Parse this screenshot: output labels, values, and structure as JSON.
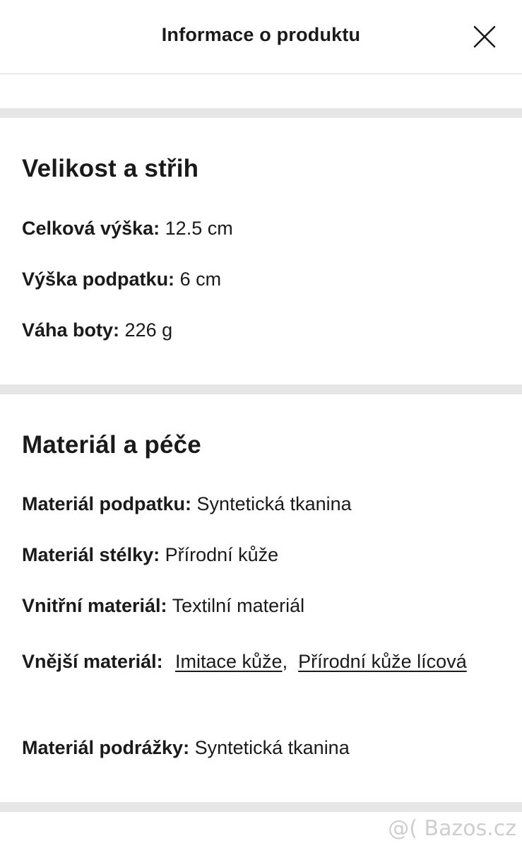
{
  "header": {
    "title": "Informace o produktu",
    "close_icon": "close-icon"
  },
  "size_section": {
    "title": "Velikost a střih",
    "rows": [
      {
        "label": "Celková výška:",
        "value": "12.5 cm"
      },
      {
        "label": "Výška podpatku:",
        "value": "6 cm"
      },
      {
        "label": "Váha boty:",
        "value": "226 g"
      }
    ]
  },
  "material_section": {
    "title": "Materiál a péče",
    "rows": [
      {
        "label": "Materiál podpatku:",
        "value": "Syntetická tkanina"
      },
      {
        "label": "Materiál stélky:",
        "value": "Přírodní kůže"
      },
      {
        "label": "Vnitřní materiál:",
        "value": "Textilní materiál"
      }
    ],
    "outer": {
      "label": "Vnější materiál:",
      "links": [
        "Imitace kůže",
        "Přírodní kůže lícová"
      ],
      "separator": ","
    },
    "last_row": {
      "label": "Materiál podrážky:",
      "value": "Syntetická tkanina"
    }
  },
  "watermark": "@( Bazos.cz",
  "colors": {
    "text": "#1a1a1a",
    "divider": "#e6e6e6",
    "background": "#ffffff"
  }
}
